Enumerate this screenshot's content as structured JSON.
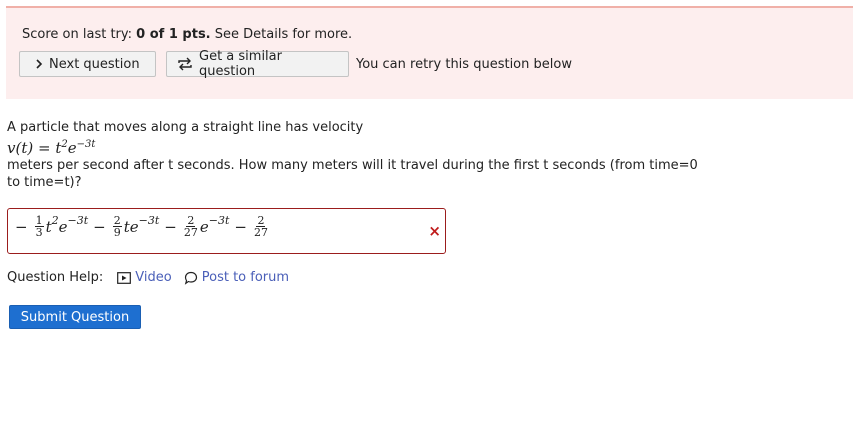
{
  "notice": {
    "score_prefix": "Score on last try:",
    "score_value": "0 of 1 pts.",
    "score_suffix": "See Details for more.",
    "next_button": "Next question",
    "similar_button": "Get a similar question",
    "retry_text": "You can retry this question below"
  },
  "question": {
    "line1": "A particle that moves along a straight line has velocity",
    "velocity_lhs": "v(t)",
    "equals": "=",
    "velocity_base": "t",
    "velocity_exp1": "2",
    "velocity_e": "e",
    "velocity_exp2": "−3t",
    "line2": "meters per second after t seconds. How many meters will it travel during the first t seconds (from time=0 to time=t)?"
  },
  "answer": {
    "minus1": "−",
    "f1_num": "1",
    "f1_den": "3",
    "t1": "t",
    "t1_exp": "2",
    "e1": "e",
    "e1_exp": "−3t",
    "minus2": "−",
    "f2_num": "2",
    "f2_den": "9",
    "t2": "te",
    "e2_exp": "−3t",
    "minus3": "−",
    "f3_num": "2",
    "f3_den": "27",
    "e3": "e",
    "e3_exp": "−3t",
    "minus4": "−",
    "f4_num": "2",
    "f4_den": "27",
    "status_mark": "×"
  },
  "help": {
    "label": "Question Help:",
    "video": "Video",
    "forum": "Post to forum"
  },
  "submit_label": "Submit Question",
  "colors": {
    "notice_bg": "#fdeeee",
    "error_border": "#9b1d1d",
    "link": "#4a5fb8",
    "submit_bg": "#1e6fd0"
  },
  "icons": {
    "next": "chevron-right-icon",
    "similar": "retry-arrows-icon",
    "wrong": "close-icon",
    "video": "video-icon",
    "forum": "speech-bubble-icon"
  }
}
